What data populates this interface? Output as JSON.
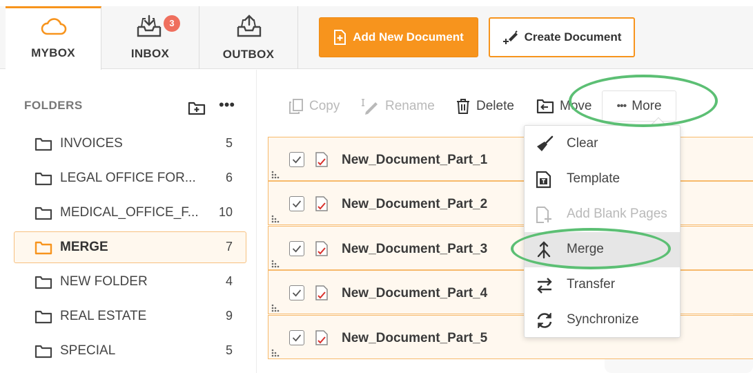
{
  "tabs": [
    {
      "label": "MYBOX",
      "icon": "cloud-icon",
      "active": true
    },
    {
      "label": "INBOX",
      "icon": "inbox-download-icon",
      "badge": "3"
    },
    {
      "label": "OUTBOX",
      "icon": "outbox-upload-icon"
    }
  ],
  "actions": {
    "add_new_document": "Add New Document",
    "create_document": "Create Document"
  },
  "sidebar": {
    "title": "FOLDERS",
    "folders": [
      {
        "name": "INVOICES",
        "count": "5"
      },
      {
        "name": "LEGAL OFFICE FOR...",
        "count": "6"
      },
      {
        "name": "MEDICAL_OFFICE_F...",
        "count": "10"
      },
      {
        "name": "MERGE",
        "count": "7",
        "active": true
      },
      {
        "name": "NEW FOLDER",
        "count": "4"
      },
      {
        "name": "REAL ESTATE",
        "count": "9"
      },
      {
        "name": "SPECIAL",
        "count": "5"
      }
    ]
  },
  "toolbar": {
    "copy": "Copy",
    "rename": "Rename",
    "delete": "Delete",
    "move": "Move",
    "more": "More"
  },
  "documents": [
    {
      "name": "New_Document_Part_1",
      "checked": true
    },
    {
      "name": "New_Document_Part_2",
      "checked": true
    },
    {
      "name": "New_Document_Part_3",
      "checked": true
    },
    {
      "name": "New_Document_Part_4",
      "checked": true
    },
    {
      "name": "New_Document_Part_5",
      "checked": true
    }
  ],
  "more_menu": [
    {
      "label": "Clear",
      "icon": "broom-icon"
    },
    {
      "label": "Template",
      "icon": "template-icon"
    },
    {
      "label": "Add Blank Pages",
      "icon": "add-page-icon",
      "disabled": true
    },
    {
      "label": "Merge",
      "icon": "merge-icon",
      "highlighted": true
    },
    {
      "label": "Transfer",
      "icon": "transfer-arrows-icon"
    },
    {
      "label": "Synchronize",
      "icon": "sync-icon"
    }
  ],
  "colors": {
    "accent": "#f7941d",
    "badge": "#ef6f5e",
    "annotation_ring": "#5cbf74",
    "row_bg": "#fff8ef"
  }
}
